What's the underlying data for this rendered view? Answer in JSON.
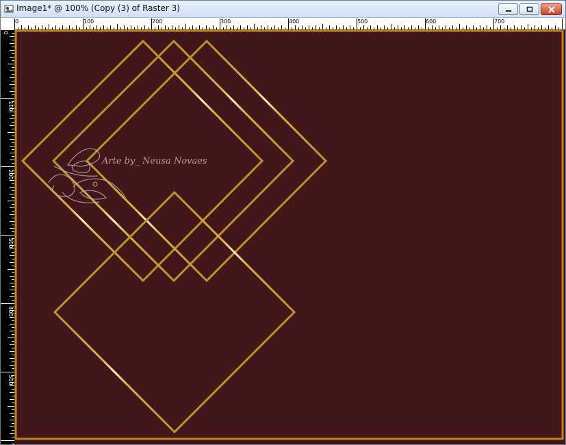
{
  "window": {
    "title": "Image1* @ 100% (Copy (3) of Raster 3)",
    "icon": "image-document-icon"
  },
  "controls": {
    "minimize": "minimize-icon",
    "maximize": "maximize-icon",
    "close": "close-icon"
  },
  "ruler": {
    "top_labels": [
      "0",
      "100",
      "200",
      "300",
      "400",
      "500",
      "600",
      "700"
    ],
    "left_labels": [
      "0",
      "100",
      "200",
      "300",
      "400",
      "500"
    ]
  },
  "canvas": {
    "background_color": "#42171a",
    "frame_color": "#b8861c",
    "line_color": "#b08a2a"
  },
  "watermark": {
    "text": "Arte by_ Neusa Novaes"
  }
}
